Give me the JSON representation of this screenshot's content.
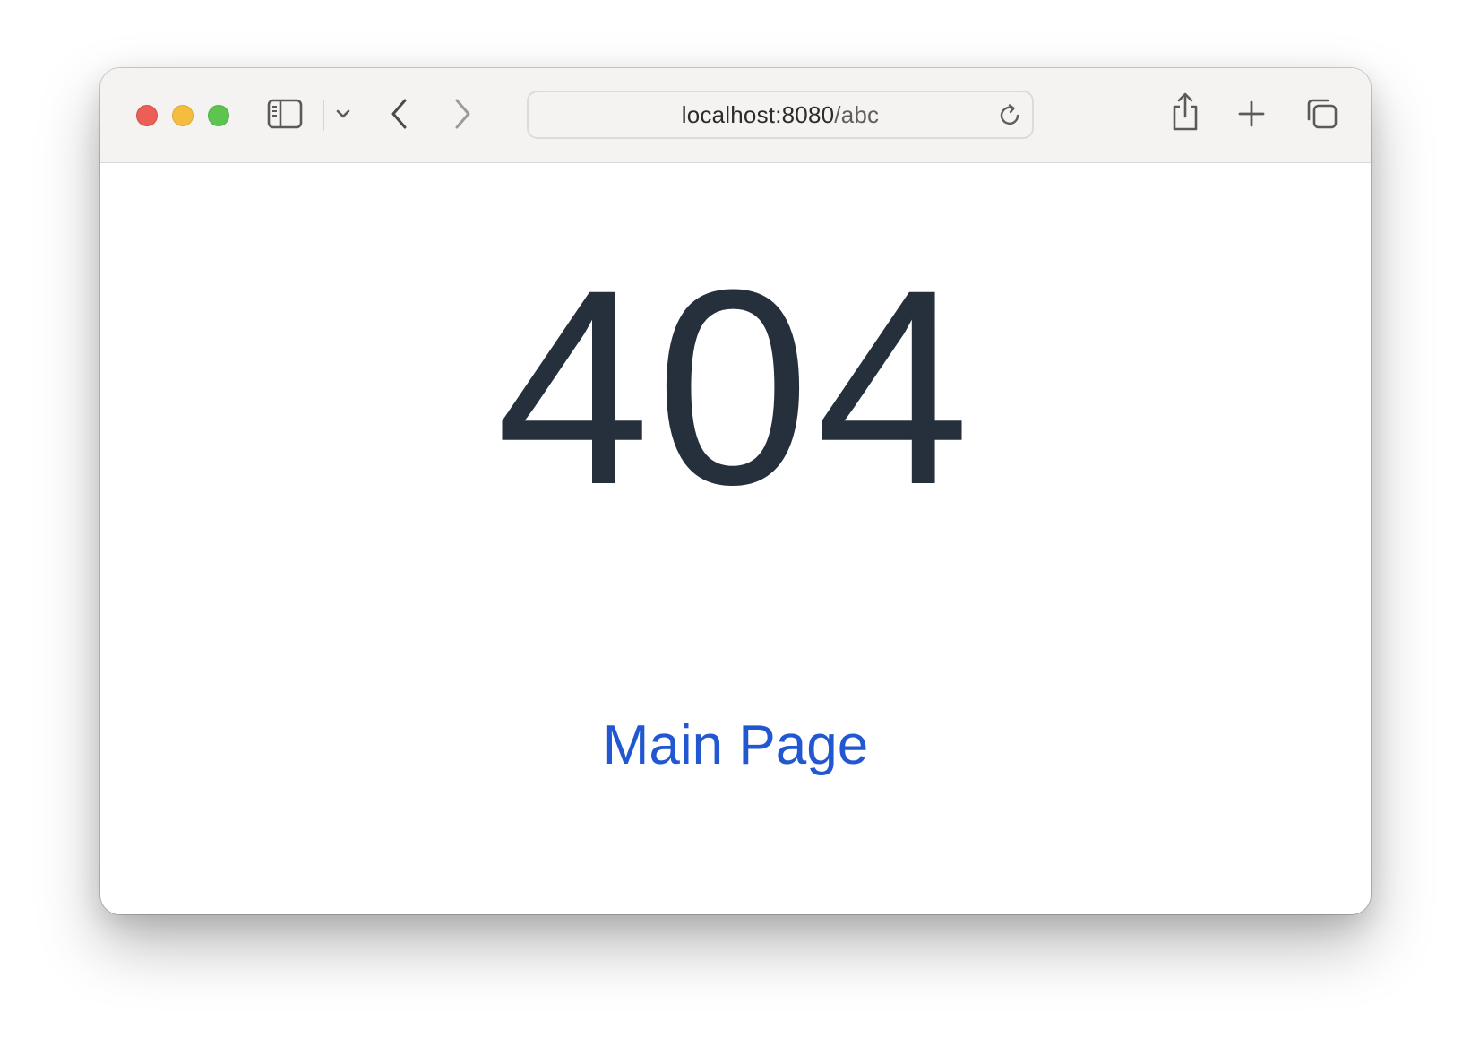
{
  "browser": {
    "url": {
      "host": "localhost:8080",
      "path": "/abc"
    },
    "icons": {
      "sidebar": "sidebar-icon",
      "tab_group_menu": "chevron-down-icon",
      "back": "chevron-left-icon",
      "forward": "chevron-right-icon",
      "reload": "reload-icon",
      "share": "share-icon",
      "new_tab": "plus-icon",
      "tab_overview": "tab-overview-icon"
    }
  },
  "page": {
    "error_code": "404",
    "link_label": "Main Page"
  },
  "colors": {
    "close": "#ec5f56",
    "minimize": "#f4bd3e",
    "zoom": "#5cc44f",
    "heading": "#26303c",
    "link": "#2257d2"
  }
}
